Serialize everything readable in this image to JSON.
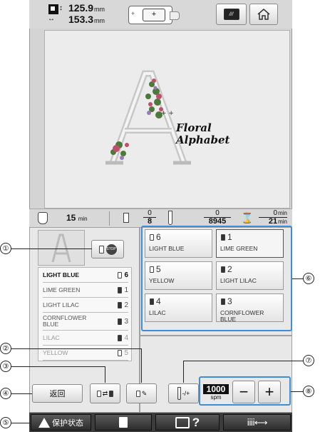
{
  "topbar": {
    "width_value": "125.9",
    "width_unit": "mm",
    "height_value": "153.3",
    "height_unit": "mm",
    "design_title_line1": "Floral",
    "design_title_line2": "Alphabet",
    "icons": [
      "size-icon",
      "frame-icon",
      "settings-icon",
      "home-icon"
    ]
  },
  "status": {
    "remaining_time": "15",
    "remaining_unit": "min",
    "color_index": "0",
    "color_total": "8",
    "stitch_index": "0",
    "stitch_total": "8945",
    "time_current": "0",
    "time_total": "21",
    "time_unit": "min"
  },
  "thread_list": [
    {
      "name": "LIGHT BLUE",
      "num": "6"
    },
    {
      "name": "LIME GREEN",
      "num": "1"
    },
    {
      "name": "LIGHT LILAC",
      "num": "2"
    },
    {
      "name": "CORNFLOWER\nBLUE",
      "num": "3"
    },
    {
      "name": "LILAC",
      "num": "4"
    },
    {
      "name": "YELLOW",
      "num": "5"
    }
  ],
  "needle_tiles": [
    {
      "num": "6",
      "name": "LIGHT BLUE",
      "selected": false
    },
    {
      "num": "1",
      "name": "LIME GREEN",
      "selected": true
    },
    {
      "num": "5",
      "name": "YELLOW",
      "selected": false
    },
    {
      "num": "2",
      "name": "LIGHT LILAC",
      "selected": false
    },
    {
      "num": "4",
      "name": "LILAC",
      "selected": false
    },
    {
      "num": "3",
      "name": "CORNFLOWER BLUE",
      "selected": false
    }
  ],
  "controls": {
    "back_label": "返回",
    "speed_value": "1000",
    "speed_unit": "spm",
    "minus": "−",
    "plus": "+",
    "tension_label": "-/+"
  },
  "bottombar": {
    "lock_label": "保护状态",
    "help_label": "?"
  },
  "callouts": [
    "①",
    "②",
    "③",
    "④",
    "⑤",
    "⑥",
    "⑦",
    "⑧"
  ],
  "colors": {
    "highlight_border": "#3b8fd9",
    "screen_bg": "#d4d4d4",
    "bottom_bar": "#3c3c3c"
  }
}
